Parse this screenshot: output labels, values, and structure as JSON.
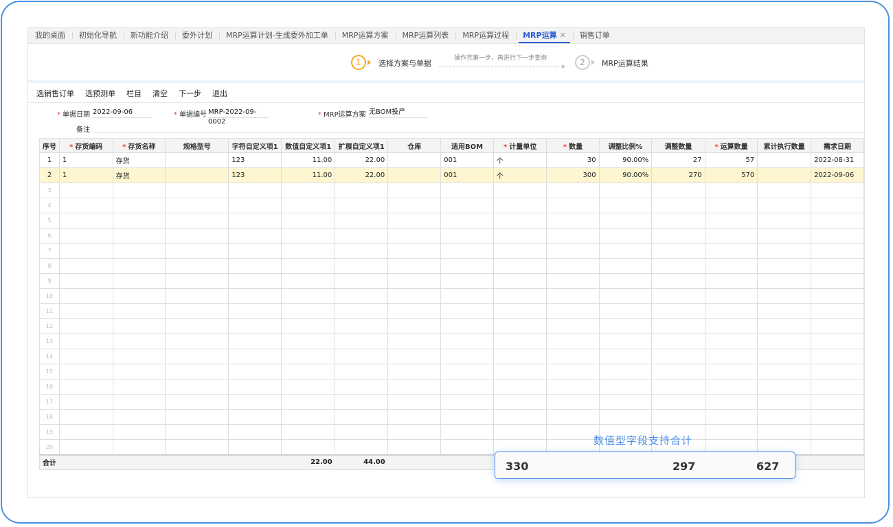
{
  "tabs": [
    {
      "label": "我的桌面"
    },
    {
      "label": "初始化导航"
    },
    {
      "label": "新功能介绍"
    },
    {
      "label": "委外计划"
    },
    {
      "label": "MRP运算计划-生成委外加工单"
    },
    {
      "label": "MRP运算方案"
    },
    {
      "label": "MRP运算列表"
    },
    {
      "label": "MRP运算过程"
    },
    {
      "label": "MRP运算",
      "active": true,
      "close": "✕"
    },
    {
      "label": "销售订单"
    }
  ],
  "steps": {
    "step1_num": "1",
    "step1_label": "选择方案与单据",
    "hint": "操作完第一步，再进行下一步查询",
    "step2_num": "2",
    "step2_label": "MRP运算结果"
  },
  "toolbar": [
    "选销售订单",
    "选预测单",
    "栏目",
    "清空",
    "下一步",
    "退出"
  ],
  "form": {
    "date_label": "单据日期",
    "date_value": "2022-09-06",
    "no_label": "单据编号",
    "no_value": "MRP-2022-09-0002",
    "plan_label": "MRP运算方案",
    "plan_value": "无BOM投产",
    "remark_label": "备注",
    "remark_value": ""
  },
  "columns": [
    {
      "label": "序号",
      "req": false,
      "w": 26
    },
    {
      "label": "存货编码",
      "req": true,
      "w": 78
    },
    {
      "label": "存货名称",
      "req": true,
      "w": 77
    },
    {
      "label": "规格型号",
      "req": false,
      "w": 93
    },
    {
      "label": "字符自定义项1",
      "req": false,
      "w": 77
    },
    {
      "label": "数值自定义项1",
      "req": false,
      "w": 78
    },
    {
      "label": "扩展自定义项1",
      "req": false,
      "w": 77
    },
    {
      "label": "仓库",
      "req": false,
      "w": 78
    },
    {
      "label": "适用BOM",
      "req": false,
      "w": 77
    },
    {
      "label": "计量单位",
      "req": true,
      "w": 78
    },
    {
      "label": "数量",
      "req": true,
      "w": 77
    },
    {
      "label": "调整比例%",
      "req": false,
      "w": 77
    },
    {
      "label": "调整数量",
      "req": false,
      "w": 78
    },
    {
      "label": "运算数量",
      "req": true,
      "w": 77
    },
    {
      "label": "累计执行数量",
      "req": false,
      "w": 78
    },
    {
      "label": "需求日期",
      "req": false,
      "w": 77
    }
  ],
  "rows": [
    [
      "1",
      "1",
      "存货",
      "",
      "123",
      "11.00",
      "22.00",
      "",
      "001",
      "个",
      "30",
      "90.00%",
      "27",
      "57",
      "",
      "2022-08-31"
    ],
    [
      "2",
      "1",
      "存货",
      "",
      "123",
      "11.00",
      "22.00",
      "",
      "001",
      "个",
      "300",
      "90.00%",
      "270",
      "570",
      "",
      "2022-09-06"
    ]
  ],
  "empty_rows": [
    "3",
    "4",
    "5",
    "6",
    "7",
    "8",
    "9",
    "10",
    "11",
    "12",
    "13",
    "14",
    "15",
    "16",
    "17",
    "18",
    "19",
    "20"
  ],
  "totals": [
    "合计",
    "",
    "",
    "",
    "",
    "22.00",
    "44.00",
    "",
    "",
    "",
    "330",
    "",
    "297",
    "627",
    "",
    ""
  ],
  "callout": {
    "title": "数值型字段支持合计",
    "v1": "330",
    "v2": "297",
    "v3": "627"
  },
  "colors": {
    "accent": "#2a5bd7",
    "step_active": "#f5a623",
    "highlight_row": "#fdf6d0",
    "callout": "#4a8fe8"
  }
}
